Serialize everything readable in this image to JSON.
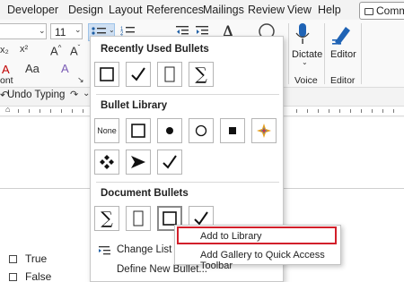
{
  "tabs": [
    "Developer",
    "Design",
    "Layout",
    "References",
    "Mailings",
    "Review",
    "View",
    "Help"
  ],
  "comments_label": "Comme",
  "ribbon": {
    "font_size": "11",
    "paragraph_glyphs": {
      "increase_font": "A^",
      "decrease_font": "Aˇ",
      "clear_format": "A"
    },
    "dictate_label": "Dictate",
    "voice_label": "Voice",
    "editor_label": "Editor",
    "editor_group_label": "Editor",
    "font_group_label": "ont"
  },
  "qat": {
    "undo_label": "Undo Typing"
  },
  "bullet_panel": {
    "recently_used_title": "Recently Used Bullets",
    "library_title": "Bullet Library",
    "none_label": "None",
    "document_title": "Document Bullets",
    "change_level_label": "Change List Leve",
    "define_bullet_label": "Define New Bullet..."
  },
  "context_menu": {
    "add_to_library": "Add to Library",
    "add_gallery": "Add Gallery to Quick Access Toolbar"
  },
  "document": {
    "items": [
      "True",
      "False"
    ]
  }
}
